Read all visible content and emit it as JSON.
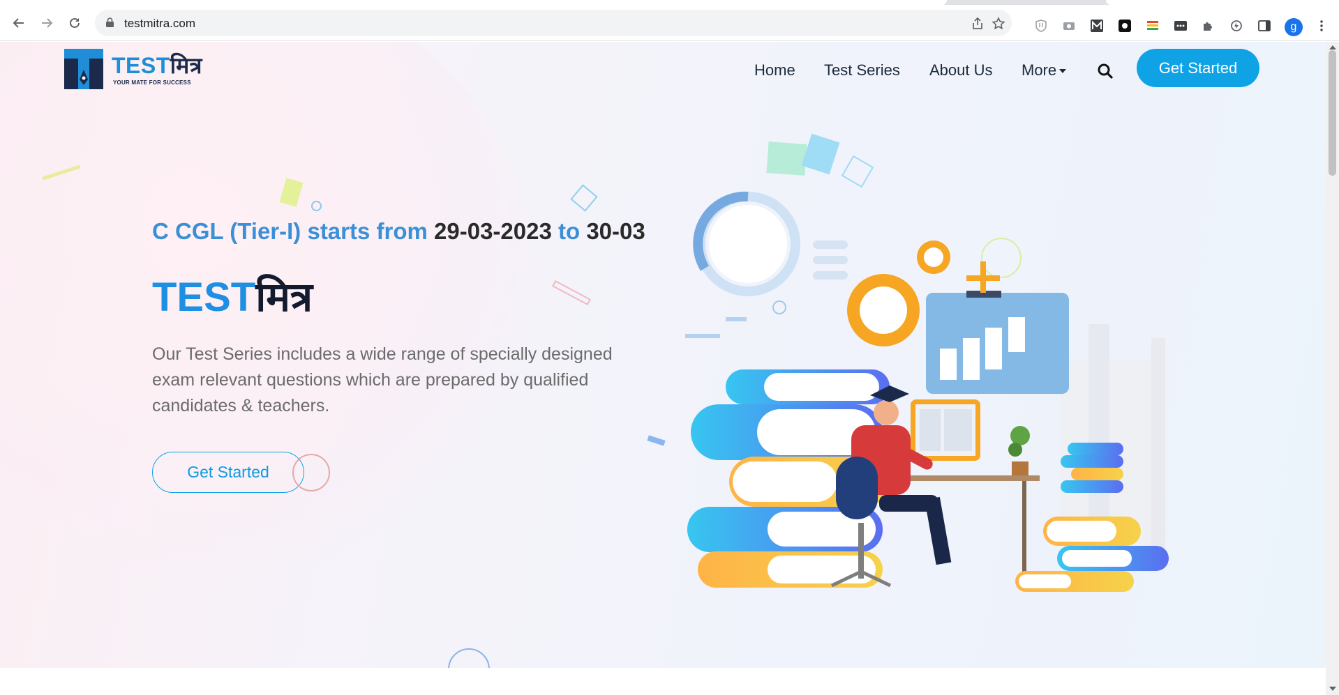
{
  "browser": {
    "url": "testmitra.com",
    "profile_initial": "g",
    "icons": [
      "back-arrow-icon",
      "forward-arrow-icon",
      "reload-icon",
      "lock-icon",
      "share-icon",
      "bookmark-star-icon",
      "brave-shield-icon",
      "camera-extension-icon",
      "m-extension-icon",
      "dark-extension-icon",
      "colors-extension-icon",
      "dots-extension-icon",
      "puzzle-extensions-icon",
      "refresh-extension-icon",
      "sidepanel-icon",
      "kebab-menu-icon"
    ]
  },
  "header": {
    "logo": {
      "word_en": "TEST",
      "word_hi": "मित्र",
      "tagline": "YOUR MATE FOR SUCCESS"
    },
    "nav": [
      {
        "label": "Home"
      },
      {
        "label": "Test Series"
      },
      {
        "label": "About Us"
      },
      {
        "label": "More"
      }
    ],
    "cta_label": "Get Started"
  },
  "hero": {
    "ticker": {
      "part1": "C CGL (Tier-I) starts from ",
      "date1": "29-03-2023",
      "part2": " to ",
      "date2": "30-03"
    },
    "title_en": "TEST",
    "title_hi": "मित्र",
    "description": "Our Test Series includes a wide range of specially designed exam relevant questions which are prepared by qualified candidates & teachers.",
    "cta_label": "Get Started"
  },
  "colors": {
    "brand_blue": "#0fa3e6",
    "title_blue": "#1e8fe2",
    "dark": "#141a2e"
  }
}
